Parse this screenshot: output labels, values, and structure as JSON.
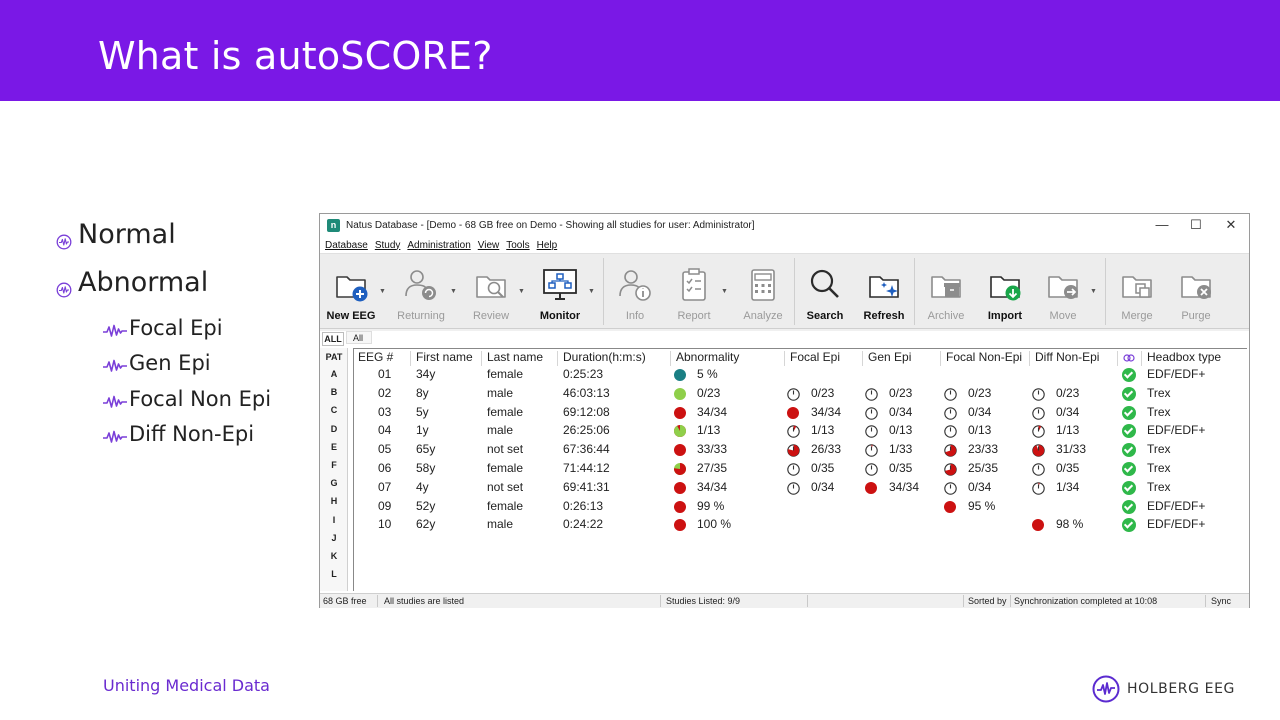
{
  "slide": {
    "title": "What is autoSCORE?",
    "bullets": [
      {
        "text": "Normal",
        "sub": []
      },
      {
        "text": "Abnormal",
        "sub": [
          "Focal Epi",
          "Gen Epi",
          "Focal Non Epi",
          "Diff Non-Epi"
        ]
      }
    ],
    "footer_text": "Uniting Medical Data",
    "brand": "HOLBERG EEG"
  },
  "window": {
    "app_icon_letter": "n",
    "title": "Natus Database - [Demo - 68 GB free on Demo - Showing all studies for user: Administrator]",
    "controls": [
      "—",
      "☐",
      "✕"
    ],
    "menu": [
      "Database",
      "Study",
      "Administration",
      "View",
      "Tools",
      "Help"
    ],
    "toolbar": [
      {
        "label": "New EEG",
        "icon": "folder-plus-icon",
        "enabled": true,
        "dropdown": true
      },
      {
        "label": "Returning",
        "icon": "user-refresh-icon",
        "enabled": false,
        "dropdown": true
      },
      {
        "label": "Review",
        "icon": "folder-search-icon",
        "enabled": false,
        "dropdown": true
      },
      {
        "label": "Monitor",
        "icon": "monitor-network-icon",
        "enabled": true,
        "dropdown": true
      },
      {
        "label": "Info",
        "icon": "user-info-icon",
        "enabled": false,
        "dropdown": false
      },
      {
        "label": "Report",
        "icon": "clipboard-check-icon",
        "enabled": false,
        "dropdown": true
      },
      {
        "label": "Analyze",
        "icon": "calculator-icon",
        "enabled": false,
        "dropdown": false
      },
      {
        "label": "Search",
        "icon": "search-icon",
        "enabled": true,
        "dropdown": false
      },
      {
        "label": "Refresh",
        "icon": "folder-sparkle-icon",
        "enabled": true,
        "dropdown": false
      },
      {
        "label": "Archive",
        "icon": "folder-archive-icon",
        "enabled": false,
        "dropdown": false
      },
      {
        "label": "Import",
        "icon": "folder-import-icon",
        "enabled": true,
        "dropdown": false
      },
      {
        "label": "Move",
        "icon": "folder-move-icon",
        "enabled": false,
        "dropdown": true
      },
      {
        "label": "Merge",
        "icon": "folder-merge-icon",
        "enabled": false,
        "dropdown": false
      },
      {
        "label": "Purge",
        "icon": "folder-delete-icon",
        "enabled": false,
        "dropdown": false
      }
    ],
    "tabs": {
      "all_active": "ALL",
      "all": "All"
    },
    "letters": [
      "PAT",
      "A",
      "B",
      "C",
      "D",
      "E",
      "F",
      "G",
      "H",
      "I",
      "J",
      "K",
      "L"
    ],
    "columns": [
      "EEG #",
      "First name",
      "Last name",
      "Duration(h:m:s)",
      "Abnormality",
      "Focal Epi",
      "Gen Epi",
      "Focal Non-Epi",
      "Diff Non-Epi",
      "",
      "Headbox type"
    ],
    "rows": [
      {
        "eeg": "01",
        "first": "34y",
        "last": "female",
        "dur": "0:25:23",
        "abn": {
          "v": "5 %",
          "c": "#1a7f84",
          "f": 1
        },
        "fe": null,
        "ge": null,
        "fne": null,
        "dne": null,
        "head": "EDF/EDF+"
      },
      {
        "eeg": "02",
        "first": "8y",
        "last": "male",
        "dur": "46:03:13",
        "abn": {
          "v": "0/23",
          "c": "#8fcf4a",
          "f": 1
        },
        "fe": {
          "v": "0/23",
          "k": "clock",
          "f": 0
        },
        "ge": {
          "v": "0/23",
          "k": "clock",
          "f": 0
        },
        "fne": {
          "v": "0/23",
          "k": "clock",
          "f": 0
        },
        "dne": {
          "v": "0/23",
          "k": "clock",
          "f": 0
        },
        "head": "Trex"
      },
      {
        "eeg": "03",
        "first": "5y",
        "last": "female",
        "dur": "69:12:08",
        "abn": {
          "v": "34/34",
          "c": "#cc1111",
          "f": 1
        },
        "fe": {
          "v": "34/34",
          "k": "dot",
          "f": 1
        },
        "ge": {
          "v": "0/34",
          "k": "clock",
          "f": 0
        },
        "fne": {
          "v": "0/34",
          "k": "clock",
          "f": 0
        },
        "dne": {
          "v": "0/34",
          "k": "clock",
          "f": 0
        },
        "head": "Trex"
      },
      {
        "eeg": "04",
        "first": "1y",
        "last": "male",
        "dur": "26:25:06",
        "abn": {
          "v": "1/13",
          "c": "#8fcf4a",
          "f": 0.92,
          "c2": "#cc1111"
        },
        "fe": {
          "v": "1/13",
          "k": "clock",
          "f": 0.08
        },
        "ge": {
          "v": "0/13",
          "k": "clock",
          "f": 0
        },
        "fne": {
          "v": "0/13",
          "k": "clock",
          "f": 0
        },
        "dne": {
          "v": "1/13",
          "k": "clock",
          "f": 0.08
        },
        "head": "EDF/EDF+"
      },
      {
        "eeg": "05",
        "first": "65y",
        "last": "not set",
        "dur": "67:36:44",
        "abn": {
          "v": "33/33",
          "c": "#cc1111",
          "f": 1
        },
        "fe": {
          "v": "26/33",
          "k": "clock",
          "f": 0.79
        },
        "ge": {
          "v": "1/33",
          "k": "clock",
          "f": 0.03
        },
        "fne": {
          "v": "23/33",
          "k": "clock",
          "f": 0.7
        },
        "dne": {
          "v": "31/33",
          "k": "clock",
          "f": 0.94
        },
        "head": "Trex"
      },
      {
        "eeg": "06",
        "first": "58y",
        "last": "female",
        "dur": "71:44:12",
        "abn": {
          "v": "27/35",
          "c": "#cc1111",
          "f": 0.77,
          "c2": "#8fcf4a"
        },
        "fe": {
          "v": "0/35",
          "k": "clock",
          "f": 0
        },
        "ge": {
          "v": "0/35",
          "k": "clock",
          "f": 0
        },
        "fne": {
          "v": "25/35",
          "k": "clock",
          "f": 0.71
        },
        "dne": {
          "v": "0/35",
          "k": "clock",
          "f": 0
        },
        "head": "Trex"
      },
      {
        "eeg": "07",
        "first": "4y",
        "last": "not set",
        "dur": "69:41:31",
        "abn": {
          "v": "34/34",
          "c": "#cc1111",
          "f": 1
        },
        "fe": {
          "v": "0/34",
          "k": "clock",
          "f": 0
        },
        "ge": {
          "v": "34/34",
          "k": "dot",
          "f": 1
        },
        "fne": {
          "v": "0/34",
          "k": "clock",
          "f": 0
        },
        "dne": {
          "v": "1/34",
          "k": "clock",
          "f": 0.03
        },
        "head": "Trex"
      },
      {
        "eeg": "09",
        "first": "52y",
        "last": "female",
        "dur": "0:26:13",
        "abn": {
          "v": "99 %",
          "c": "#cc1111",
          "f": 1
        },
        "fe": null,
        "ge": null,
        "fne": {
          "v": "95 %",
          "k": "dot",
          "f": 1
        },
        "dne": null,
        "head": "EDF/EDF+"
      },
      {
        "eeg": "10",
        "first": "62y",
        "last": "male",
        "dur": "0:24:22",
        "abn": {
          "v": "100 %",
          "c": "#cc1111",
          "f": 1
        },
        "fe": null,
        "ge": null,
        "fne": null,
        "dne": {
          "v": "98 %",
          "k": "dot",
          "f": 1
        },
        "head": "EDF/EDF+"
      }
    ],
    "status": [
      "68 GB free",
      "All studies are listed",
      "Studies Listed: 9/9",
      "Sorted by",
      "Synchronization completed at 10:08",
      "Sync"
    ]
  }
}
